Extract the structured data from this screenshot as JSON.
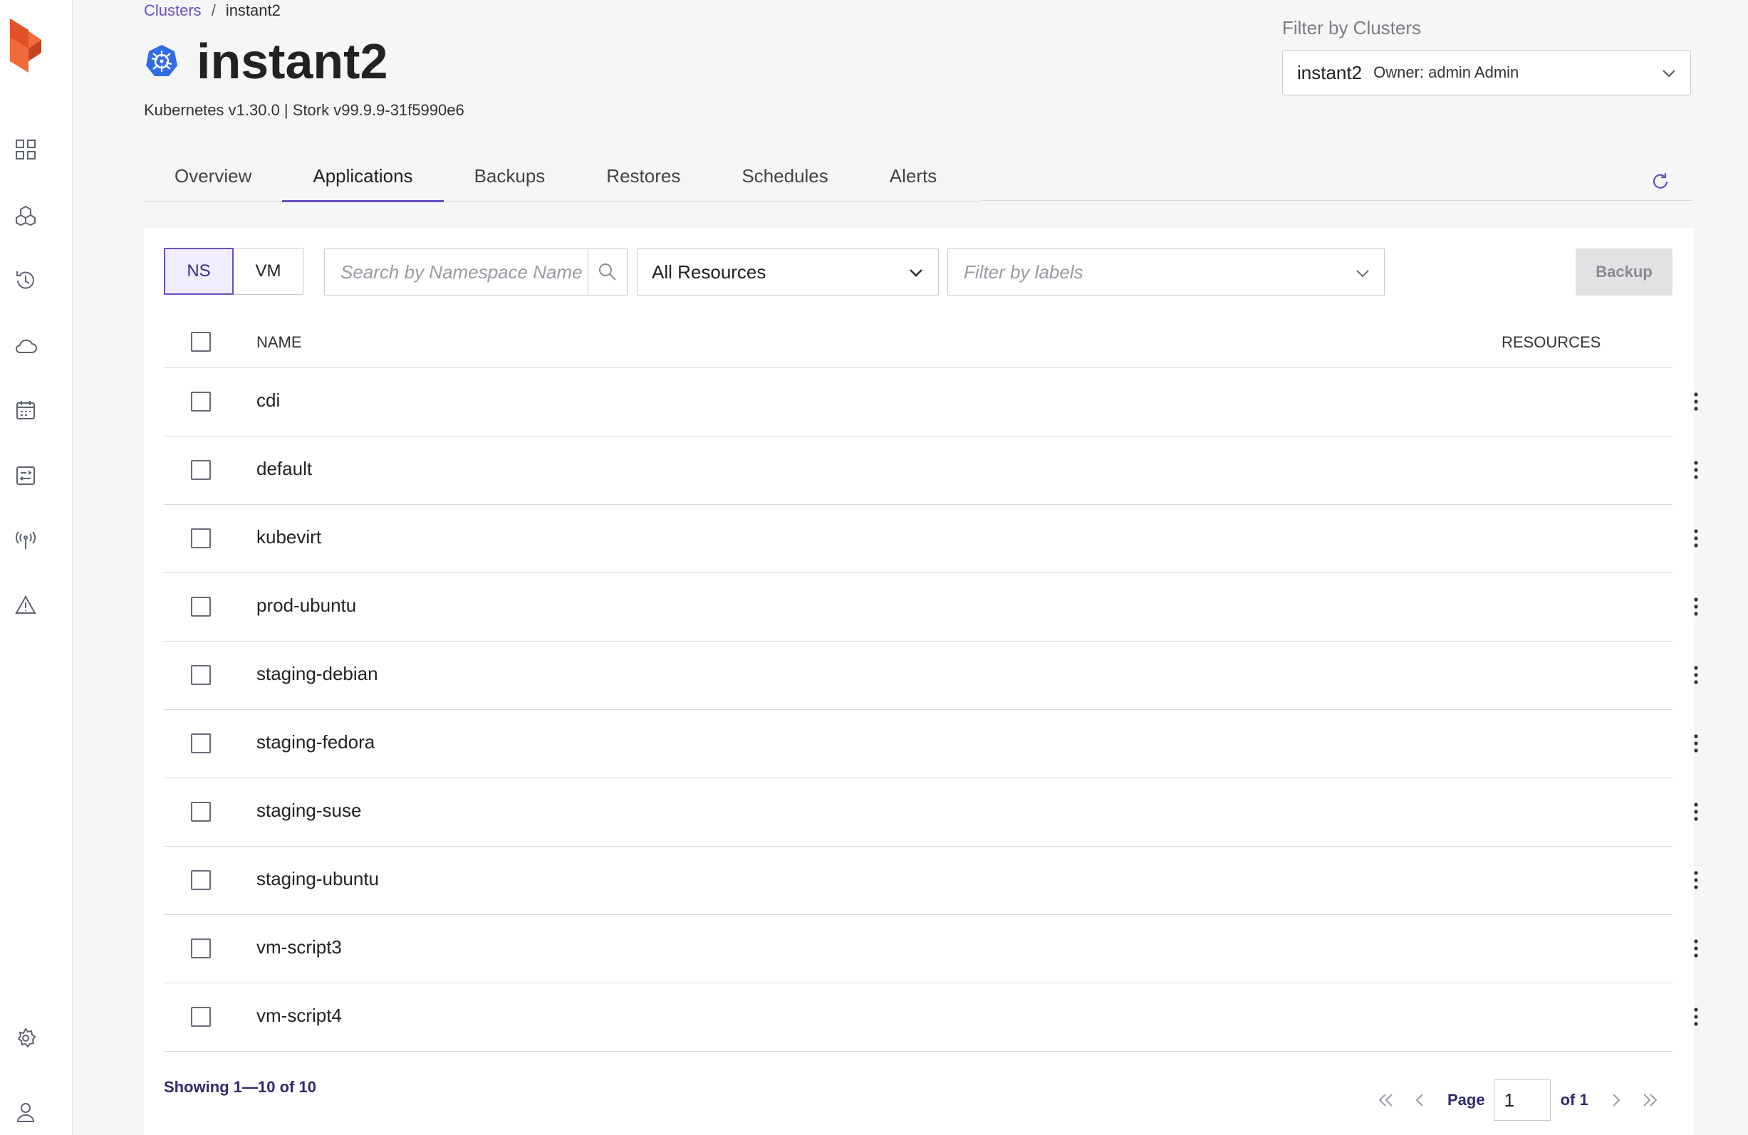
{
  "breadcrumb": {
    "parent": "Clusters",
    "separator": "/",
    "current": "instant2"
  },
  "header": {
    "title": "instant2",
    "subtitle": "Kubernetes v1.30.0 | Stork v99.9.9-31f5990e6"
  },
  "cluster_filter": {
    "label": "Filter by Clusters",
    "selected_name": "instant2",
    "selected_owner": "Owner: admin Admin"
  },
  "tabs": [
    {
      "label": "Overview"
    },
    {
      "label": "Applications"
    },
    {
      "label": "Backups"
    },
    {
      "label": "Restores"
    },
    {
      "label": "Schedules"
    },
    {
      "label": "Alerts"
    }
  ],
  "active_tab": "Applications",
  "toolbar": {
    "ns_label": "NS",
    "vm_label": "VM",
    "search_placeholder": "Search by Namespace Name",
    "resources_selected": "All Resources",
    "labels_placeholder": "Filter by labels",
    "backup_label": "Backup"
  },
  "table": {
    "columns": {
      "name": "NAME",
      "resources": "RESOURCES"
    },
    "rows": [
      {
        "name": "cdi"
      },
      {
        "name": "default"
      },
      {
        "name": "kubevirt"
      },
      {
        "name": "prod-ubuntu"
      },
      {
        "name": "staging-debian"
      },
      {
        "name": "staging-fedora"
      },
      {
        "name": "staging-suse"
      },
      {
        "name": "staging-ubuntu"
      },
      {
        "name": "vm-script3"
      },
      {
        "name": "vm-script4"
      }
    ]
  },
  "footer": {
    "showing": "Showing 1—10 of 10",
    "page_label": "Page",
    "page_value": "1",
    "page_of": "of 1"
  },
  "sidebar": {
    "icons": [
      "dashboard-icon",
      "applications-icon",
      "history-icon",
      "cloud-icon",
      "calendar-icon",
      "rules-icon",
      "antenna-icon",
      "warning-icon",
      "settings-icon",
      "user-icon"
    ]
  },
  "colors": {
    "accent": "#6a4fc4",
    "logo": "#f26b3a",
    "k8s": "#326ce5"
  }
}
